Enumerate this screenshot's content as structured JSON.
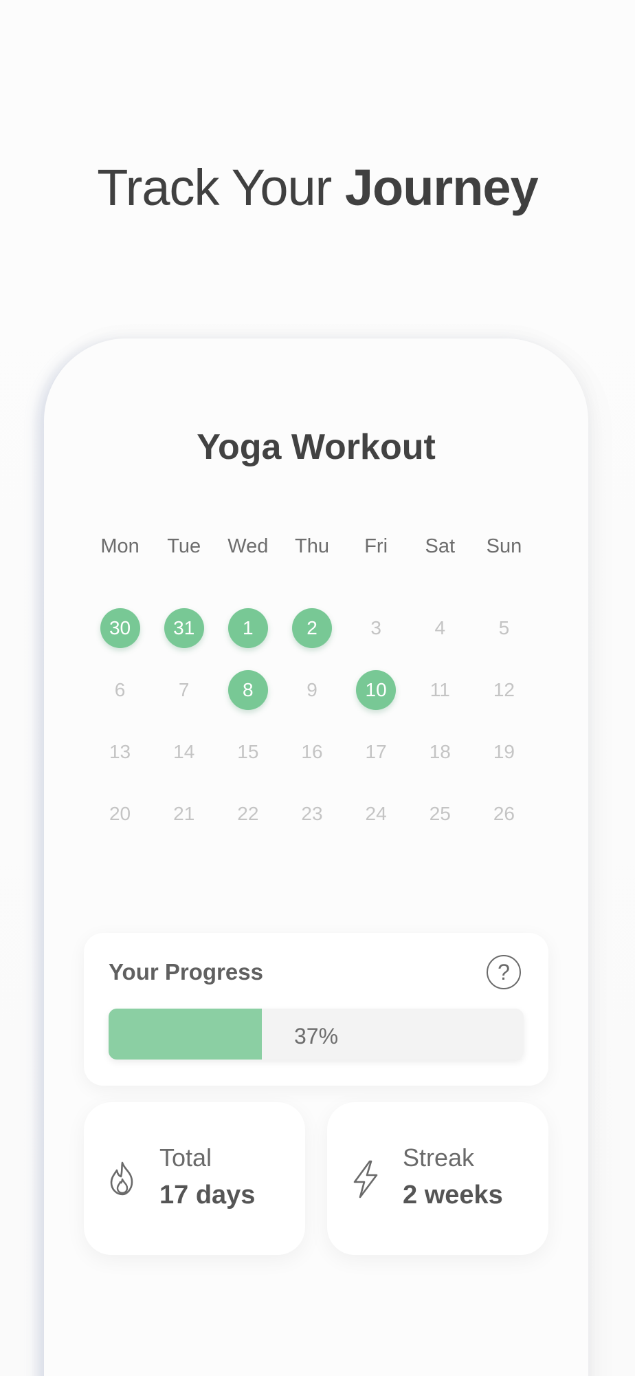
{
  "headline": {
    "light": "Track Your ",
    "bold": "Journey"
  },
  "workout": {
    "title": "Yoga Workout"
  },
  "calendar": {
    "weekdays": [
      "Mon",
      "Tue",
      "Wed",
      "Thu",
      "Fri",
      "Sat",
      "Sun"
    ],
    "weeks": [
      [
        {
          "d": "30",
          "done": true
        },
        {
          "d": "31",
          "done": true
        },
        {
          "d": "1",
          "done": true
        },
        {
          "d": "2",
          "done": true
        },
        {
          "d": "3",
          "done": false
        },
        {
          "d": "4",
          "done": false
        },
        {
          "d": "5",
          "done": false
        }
      ],
      [
        {
          "d": "6",
          "done": false
        },
        {
          "d": "7",
          "done": false
        },
        {
          "d": "8",
          "done": true
        },
        {
          "d": "9",
          "done": false
        },
        {
          "d": "10",
          "done": true
        },
        {
          "d": "11",
          "done": false
        },
        {
          "d": "12",
          "done": false
        }
      ],
      [
        {
          "d": "13",
          "done": false
        },
        {
          "d": "14",
          "done": false
        },
        {
          "d": "15",
          "done": false
        },
        {
          "d": "16",
          "done": false
        },
        {
          "d": "17",
          "done": false
        },
        {
          "d": "18",
          "done": false
        },
        {
          "d": "19",
          "done": false
        }
      ],
      [
        {
          "d": "20",
          "done": false
        },
        {
          "d": "21",
          "done": false
        },
        {
          "d": "22",
          "done": false
        },
        {
          "d": "23",
          "done": false
        },
        {
          "d": "24",
          "done": false
        },
        {
          "d": "25",
          "done": false
        },
        {
          "d": "26",
          "done": false
        }
      ]
    ]
  },
  "progress": {
    "title": "Your Progress",
    "help_icon": "question-circle-icon",
    "help_glyph": "?",
    "percent": 37,
    "label": "37%"
  },
  "stats": {
    "total": {
      "icon": "flame-icon",
      "label": "Total",
      "value": "17 days"
    },
    "streak": {
      "icon": "lightning-bolt-icon",
      "label": "Streak",
      "value": "2 weeks"
    }
  },
  "colors": {
    "accent": "#78c895",
    "progress_fill": "#8bcfa3",
    "muted_day": "#c4c4c4"
  }
}
